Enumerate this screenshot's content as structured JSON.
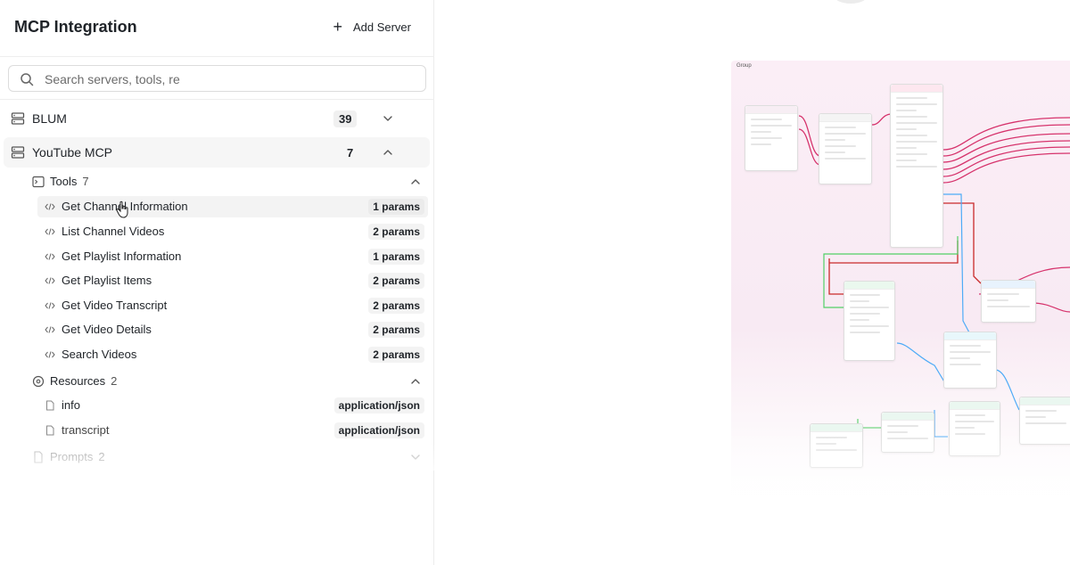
{
  "header": {
    "title": "MCP Integration",
    "add_server_label": "Add Server"
  },
  "search": {
    "placeholder": "Search servers, tools, re"
  },
  "servers": [
    {
      "name": "BLUM",
      "count": "39",
      "expanded": false
    },
    {
      "name": "YouTube MCP",
      "count": "7",
      "expanded": true
    }
  ],
  "youtube": {
    "tools_group": {
      "label": "Tools",
      "count": "7"
    },
    "tools": [
      {
        "label": "Get Channel Information",
        "params": "1 params"
      },
      {
        "label": "List Channel Videos",
        "params": "2 params"
      },
      {
        "label": "Get Playlist Information",
        "params": "1 params"
      },
      {
        "label": "Get Playlist Items",
        "params": "2 params"
      },
      {
        "label": "Get Video Transcript",
        "params": "2 params"
      },
      {
        "label": "Get Video Details",
        "params": "2 params"
      },
      {
        "label": "Search Videos",
        "params": "2 params"
      }
    ],
    "resources_group": {
      "label": "Resources",
      "count": "2"
    },
    "resources": [
      {
        "label": "info",
        "type": "application/json"
      },
      {
        "label": "transcript",
        "type": "application/json"
      }
    ],
    "prompts_group": {
      "label": "Prompts",
      "count": "2"
    }
  },
  "canvas": {
    "group_label": "Group"
  },
  "colors": {
    "accent_pink": "#d6336c",
    "edge_blue": "#4dabf7",
    "edge_red": "#c92a2a",
    "edge_green": "#51cf66",
    "group_bg": "#fbeef6"
  },
  "icons": {
    "search": "search-icon",
    "server": "server-icon",
    "tools": "terminal-icon",
    "tool_item": "code-icon",
    "resources": "resource-icon",
    "resource_item": "file-icon",
    "prompts": "prompt-icon"
  }
}
